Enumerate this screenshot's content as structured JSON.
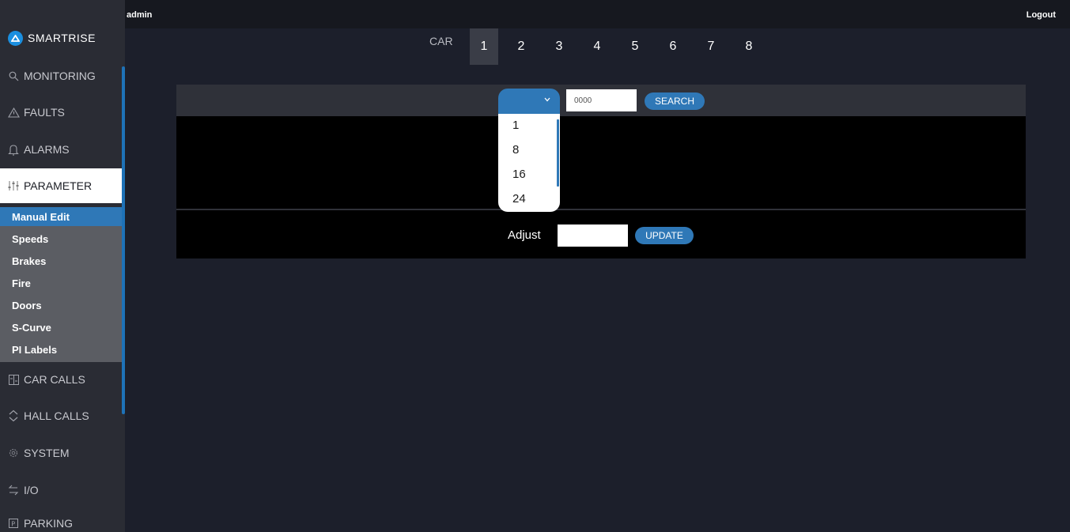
{
  "header": {
    "user": "admin",
    "logout_label": "Logout"
  },
  "brand": {
    "name": "SMARTRISE"
  },
  "sidebar": {
    "items": [
      {
        "label": "MONITORING",
        "icon": "search-icon"
      },
      {
        "label": "FAULTS",
        "icon": "warning-icon"
      },
      {
        "label": "ALARMS",
        "icon": "bell-icon"
      },
      {
        "label": "PARAMETER",
        "icon": "sliders-icon"
      },
      {
        "label": "CAR CALLS",
        "icon": "elevator-panel-icon"
      },
      {
        "label": "HALL CALLS",
        "icon": "up-down-icon"
      },
      {
        "label": "SYSTEM",
        "icon": "gear-icon"
      },
      {
        "label": "I/O",
        "icon": "arrows-icon"
      },
      {
        "label": "PARKING",
        "icon": "parking-icon"
      }
    ],
    "parameter_subitems": [
      "Manual Edit",
      "Speeds",
      "Brakes",
      "Fire",
      "Doors",
      "S-Curve",
      "PI Labels"
    ]
  },
  "car_selector": {
    "label": "CAR",
    "cars": [
      "1",
      "2",
      "3",
      "4",
      "5",
      "6",
      "7",
      "8"
    ],
    "selected": "1"
  },
  "search": {
    "input_value": "0000",
    "button_label": "SEARCH",
    "dropdown_options": [
      "1",
      "8",
      "16",
      "24"
    ]
  },
  "adjust": {
    "label": "Adjust",
    "input_value": "",
    "button_label": "UPDATE"
  }
}
